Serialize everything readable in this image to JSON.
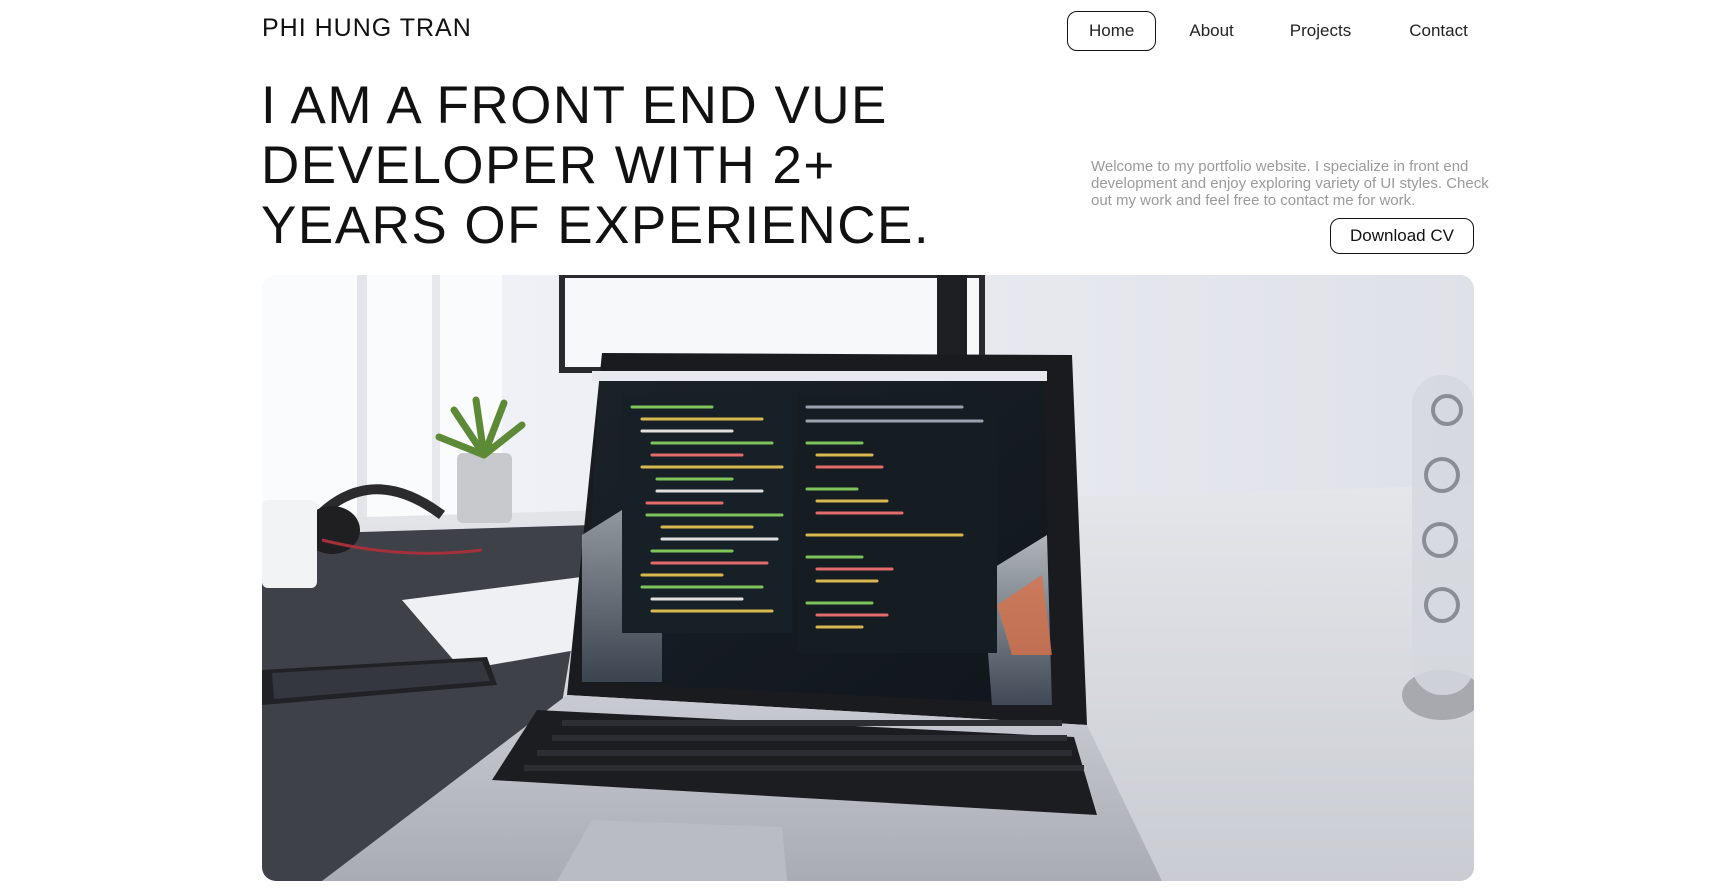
{
  "brand": {
    "name": "PHI HUNG TRAN"
  },
  "nav": {
    "items": [
      {
        "label": "Home",
        "active": true
      },
      {
        "label": "About",
        "active": false
      },
      {
        "label": "Projects",
        "active": false
      },
      {
        "label": "Contact",
        "active": false
      }
    ]
  },
  "hero": {
    "headline_lines": [
      "I AM A FRONT END VUE",
      "DEVELOPER WITH 2+",
      "YEARS OF EXPERIENCE."
    ],
    "intro": "Welcome to my portfolio website. I specialize in front end development and enjoy exploring variety of UI styles. Check out my work and feel free to contact me for work.",
    "cv_button_label": "Download CV",
    "image_subject": "laptop-with-code-editor-photo"
  },
  "colors": {
    "text": "#111111",
    "muted": "#9a9a9a",
    "border": "#111111",
    "background": "#ffffff"
  }
}
